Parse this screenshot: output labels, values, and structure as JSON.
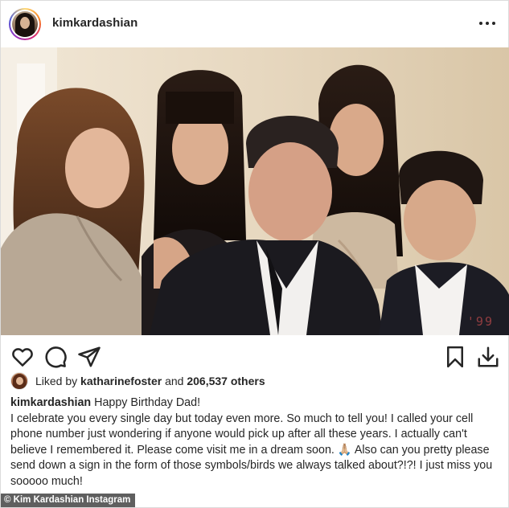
{
  "header": {
    "username": "kimkardashian",
    "more_icon": "more-horizontal-icon"
  },
  "photo": {
    "date_stamp": "'99"
  },
  "actions": {
    "icons": [
      "heart-icon",
      "comment-icon",
      "share-icon",
      "bookmark-icon",
      "download-icon"
    ]
  },
  "likes": {
    "prefix": "Liked by",
    "liker": "katharinefoster",
    "connector": "and",
    "count": "206,537",
    "suffix": "others"
  },
  "caption": {
    "username": "kimkardashian",
    "first_line": "Happy Birthday Dad!",
    "body": "I celebrate you every single day but today even more. So much to tell you! I called your cell phone number just wondering if anyone would pick up after all these years. I actually can't believe I remembered it. Please come visit me in a dream soon. 🙏🏼 Also can you pretty please send down a sign in the form of those symbols/birds we always talked about?!?! I just miss you sooooo much!"
  },
  "watermark": {
    "text": "© Kim Kardashian Instagram"
  },
  "colors": {
    "text": "#262626",
    "border": "#dbdbdb",
    "stamp": "#b8484a"
  }
}
